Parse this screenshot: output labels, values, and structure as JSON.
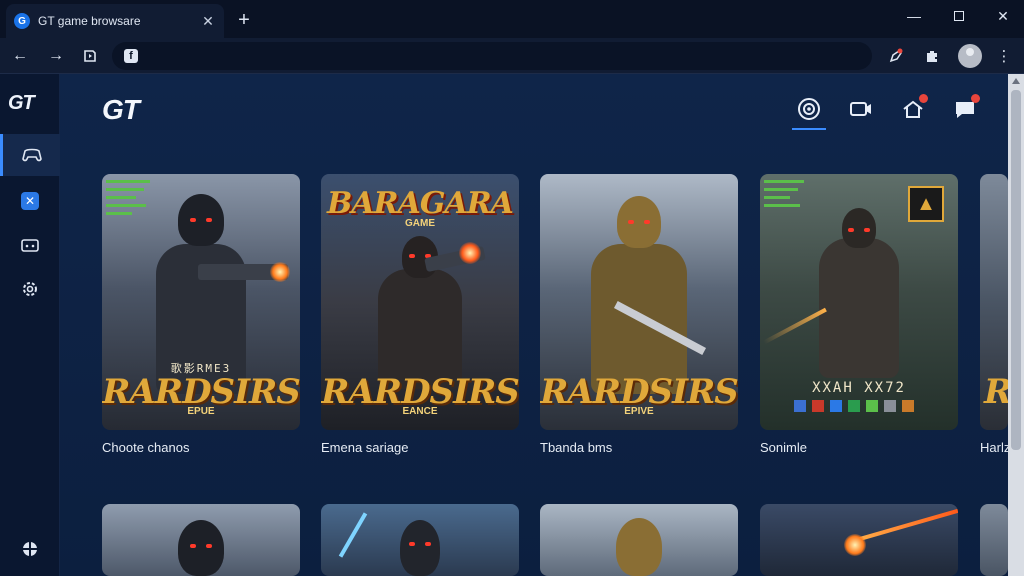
{
  "browser": {
    "tab_title": "GT game browsare",
    "tab_favicon": "G",
    "new_tab_icon": "+",
    "omnibox_icon": "f",
    "omnibox_text": ""
  },
  "app": {
    "brand": "GT",
    "side_brand": "GT"
  },
  "sidebar": {
    "items": [
      {
        "icon": "controller-icon",
        "active": true
      },
      {
        "icon": "x-app-icon",
        "active": false
      },
      {
        "icon": "gamepad-icon",
        "active": false
      },
      {
        "icon": "settings-gear-icon",
        "active": false
      },
      {
        "icon": "crosshair-icon",
        "active": false
      }
    ]
  },
  "top_icons": [
    {
      "name": "live-stream-icon",
      "active": true
    },
    {
      "name": "video-camera-icon",
      "active": false
    },
    {
      "name": "home-notification-icon",
      "badge": true
    },
    {
      "name": "chat-icon",
      "badge": true
    }
  ],
  "cards": [
    {
      "title": "Choote chanos",
      "logo": "RARDSIRS",
      "sub": "EPUE",
      "caption": "歌影RME3"
    },
    {
      "title": "Emena sariage",
      "logo": "RARDSIRS",
      "sub": "EANCE",
      "top_logo": "BARAGARA",
      "top_sub": "GAME"
    },
    {
      "title": "Tbanda bms",
      "logo": "RARDSIRS",
      "sub": "EPIVE"
    },
    {
      "title": "Sonimle",
      "logo": "XXAH XX72",
      "sub": ""
    },
    {
      "title": "Harlz",
      "logo": "R",
      "sub": ""
    }
  ],
  "colors": {
    "accent": "#3b8cff",
    "background": "#0f2549",
    "badge": "#e8453c",
    "gold": "#e0a83a"
  }
}
